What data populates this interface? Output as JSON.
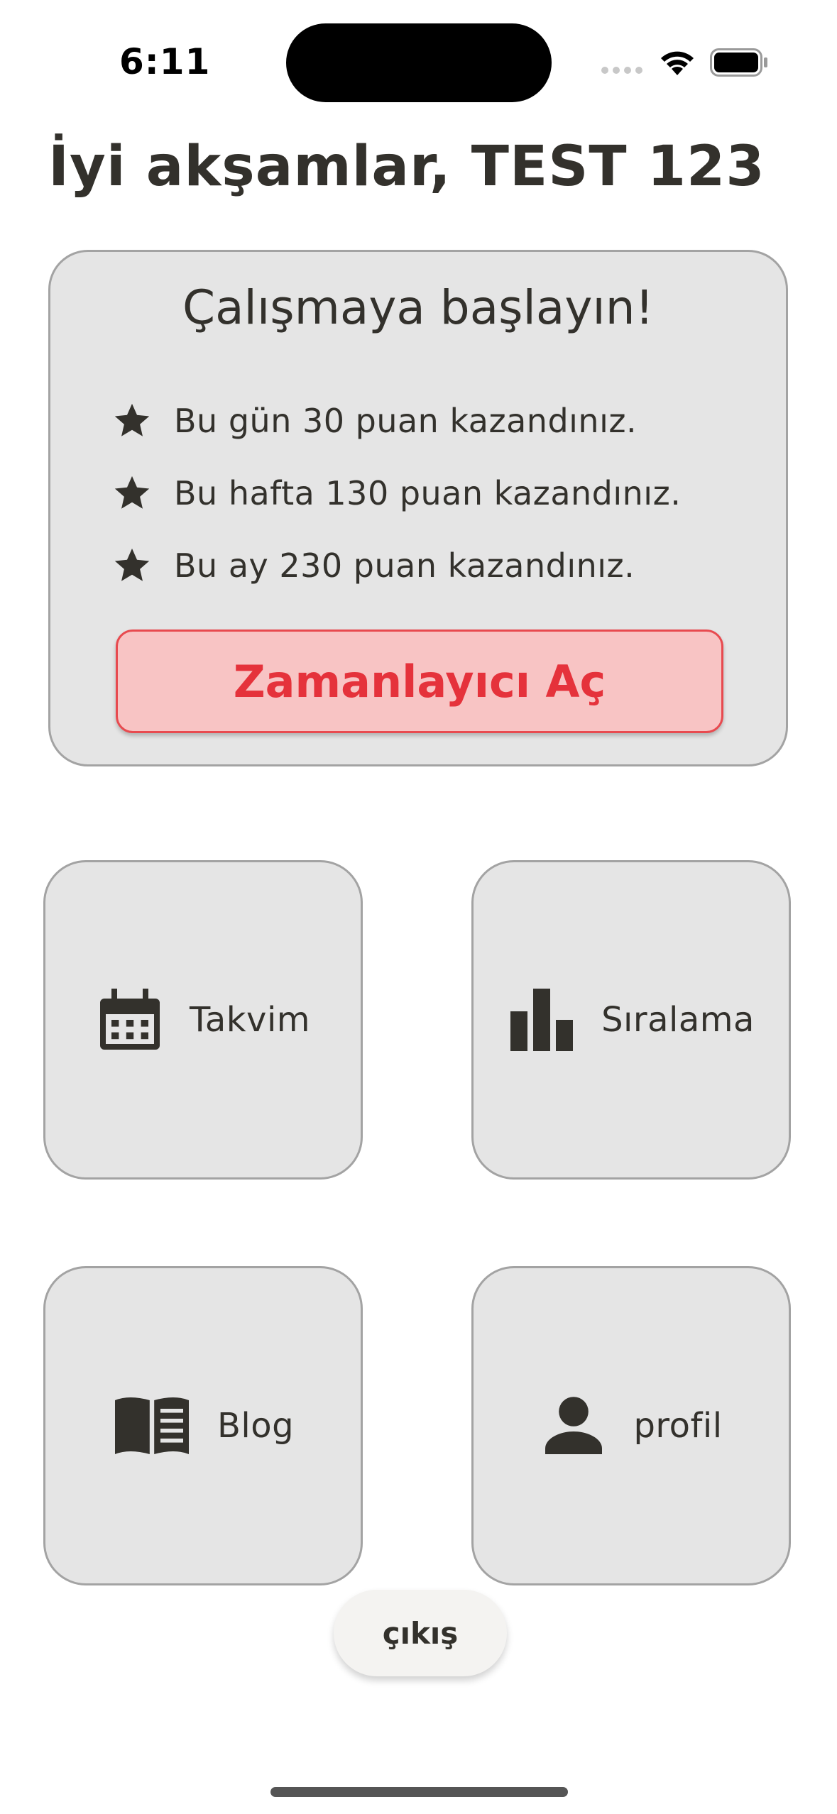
{
  "status_bar": {
    "time": "6:11"
  },
  "greeting": "İyi akşamlar, TEST 123",
  "stats_card": {
    "title": "Çalışmaya başlayın!",
    "items": [
      {
        "icon": "star-icon",
        "text": "Bu gün 30 puan kazandınız."
      },
      {
        "icon": "star-icon",
        "text": "Bu hafta 130 puan kazandınız."
      },
      {
        "icon": "star-icon",
        "text": "Bu ay 230 puan kazandınız."
      }
    ],
    "button_label": "Zamanlayıcı Aç"
  },
  "tiles": [
    {
      "icon": "calendar-icon",
      "label": "Takvim"
    },
    {
      "icon": "bar-chart-icon",
      "label": "Sıralama"
    },
    {
      "icon": "book-icon",
      "label": "Blog"
    },
    {
      "icon": "person-icon",
      "label": "profil"
    }
  ],
  "exit_label": "çıkış",
  "colors": {
    "text": "#33312c",
    "card_bg": "#e5e5e5",
    "card_border": "#a3a3a3",
    "timer_bg": "#f8c4c4",
    "timer_text": "#e5323b"
  }
}
